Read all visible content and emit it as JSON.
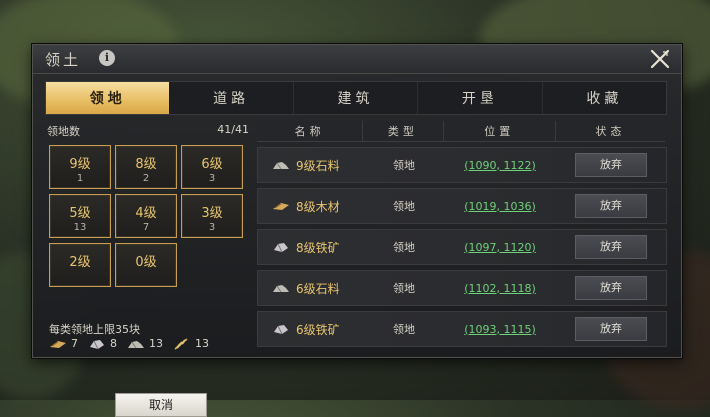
{
  "dialog": {
    "title": "领土"
  },
  "tabs": [
    {
      "label": "领地",
      "active": true
    },
    {
      "label": "道路",
      "active": false
    },
    {
      "label": "建筑",
      "active": false
    },
    {
      "label": "开垦",
      "active": false
    },
    {
      "label": "收藏",
      "active": false
    }
  ],
  "territory": {
    "count_label": "领地数",
    "count_value": "41/41",
    "levels": [
      {
        "label": "9级",
        "count": "1"
      },
      {
        "label": "8级",
        "count": "2"
      },
      {
        "label": "6级",
        "count": "3"
      },
      {
        "label": "5级",
        "count": "13"
      },
      {
        "label": "4级",
        "count": "7"
      },
      {
        "label": "3级",
        "count": "3"
      },
      {
        "label": "2级",
        "count": ""
      },
      {
        "label": "0级",
        "count": ""
      }
    ],
    "limit_text": "每类领地上限35块",
    "resources": [
      {
        "icon": "wood-icon",
        "value": "7"
      },
      {
        "icon": "iron-icon",
        "value": "8"
      },
      {
        "icon": "stone-icon",
        "value": "13"
      },
      {
        "icon": "grain-icon",
        "value": "13"
      }
    ],
    "cancel_label": "取消"
  },
  "table": {
    "headers": [
      "名称",
      "类型",
      "位置",
      "状态"
    ],
    "rows": [
      {
        "icon": "stone-icon",
        "name": "9级石料",
        "type": "领地",
        "position": "(1090, 1122)",
        "action": "放弃"
      },
      {
        "icon": "wood-icon",
        "name": "8级木材",
        "type": "领地",
        "position": "(1019, 1036)",
        "action": "放弃"
      },
      {
        "icon": "iron-icon",
        "name": "8级铁矿",
        "type": "领地",
        "position": "(1097, 1120)",
        "action": "放弃"
      },
      {
        "icon": "stone-icon",
        "name": "6级石料",
        "type": "领地",
        "position": "(1102, 1118)",
        "action": "放弃"
      },
      {
        "icon": "iron-icon",
        "name": "6级铁矿",
        "type": "领地",
        "position": "(1093, 1115)",
        "action": "放弃"
      }
    ]
  },
  "colors": {
    "accent_gold": "#e7c46f",
    "position_green": "#6fd07a"
  }
}
